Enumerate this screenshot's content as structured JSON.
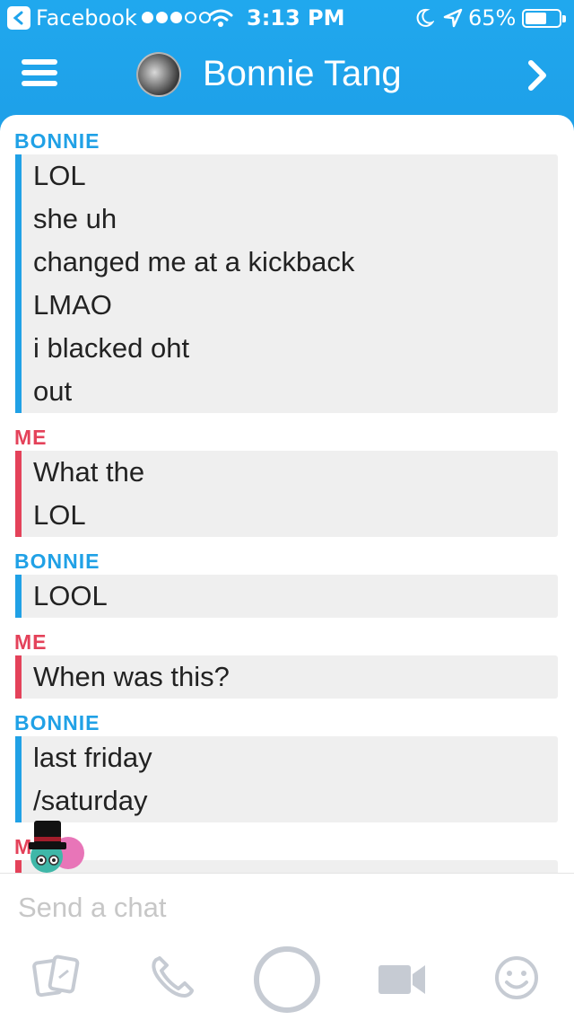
{
  "status_bar": {
    "back_app": "Facebook",
    "time": "3:13 PM",
    "battery": "65%",
    "battery_level": 0.65
  },
  "header": {
    "contact_name": "Bonnie Tang",
    "icons": [
      "menu-icon",
      "avatar",
      "chevron-right-icon"
    ],
    "background": "#1ea4ec"
  },
  "messages": [
    {
      "sender": "BONNIE",
      "from": "bonnie",
      "lines": [
        "LOL",
        "she uh",
        "changed me at a kickback",
        "LMAO",
        "i blacked oht",
        "out"
      ]
    },
    {
      "sender": "ME",
      "from": "me",
      "lines": [
        "What the",
        "LOL"
      ]
    },
    {
      "sender": "BONNIE",
      "from": "bonnie",
      "lines": [
        "LOOL"
      ]
    },
    {
      "sender": "ME",
      "from": "me",
      "lines": [
        "When was this?"
      ]
    },
    {
      "sender": "BONNIE",
      "from": "bonnie",
      "lines": [
        "last friday",
        "/saturday"
      ]
    },
    {
      "sender": "M",
      "from": "me",
      "lines": []
    }
  ],
  "colors": {
    "bonnie": "#20a1e6",
    "me": "#e4425a"
  },
  "composer": {
    "placeholder": "Send a chat",
    "tools": [
      "cards-icon",
      "phone-icon",
      "capture-button",
      "video-icon",
      "smiley-icon"
    ]
  }
}
